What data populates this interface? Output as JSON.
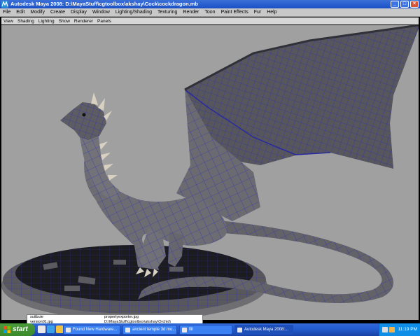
{
  "window": {
    "title": "Autodesk Maya 2008: D:\\MayaStuff\\cgtoolbox\\akshay\\Cock\\cockdragon.mb",
    "min_label": "_",
    "max_label": "□",
    "close_label": "×"
  },
  "menubar": [
    "File",
    "Edit",
    "Modify",
    "Create",
    "Display",
    "Window",
    "Lighting/Shading",
    "Texturing",
    "Render",
    "Toon",
    "Paint Effects",
    "Fur",
    "Help"
  ],
  "panel_menu": [
    "View",
    "Shading",
    "Lighting",
    "Show",
    "Renderer",
    "Panels"
  ],
  "viewport": {
    "background": "#a0a0a0",
    "mesh_color": "#5a5a5e",
    "wire_color": "#2a2ac0"
  },
  "popup": {
    "line1": "suitbuie",
    "line2": "version01.jpg",
    "line3": "propertyexporter.jpg",
    "line4": "D:\\MayaStuff\\cgtoolbox\\akshay\\Orchid\\"
  },
  "taskbar": {
    "start_label": "start",
    "tasks": [
      {
        "label": "Found New Hardware...",
        "active": false
      },
      {
        "label": "ancient temple 3d mo...",
        "active": false
      },
      {
        "label": "fill",
        "active": false
      },
      {
        "label": "Autodesk Maya 2008:...",
        "active": true
      }
    ],
    "clock": "11:19 PM"
  }
}
